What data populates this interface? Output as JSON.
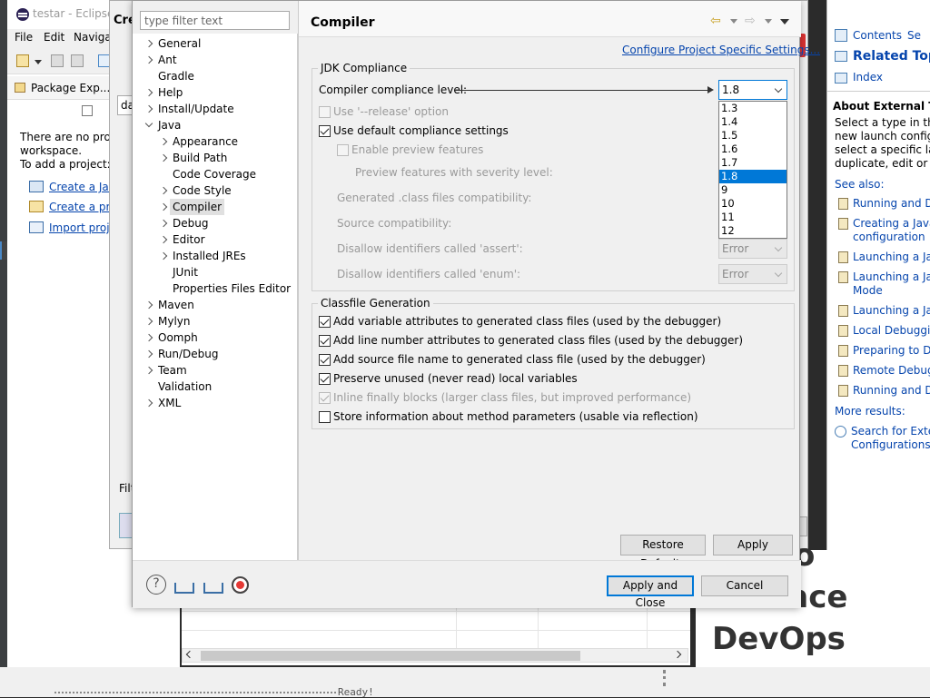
{
  "eclipse": {
    "title": "testar - Eclipse I",
    "menus": [
      "File",
      "Edit",
      "Navigat"
    ],
    "package_explorer_tab": "Package Exp...",
    "empty_text_1": "There are no projec",
    "empty_text_2": "workspace.",
    "empty_text_3": "To add a project:",
    "links": [
      "Create a Java",
      "Create a proj",
      "Import proje"
    ],
    "status": "Ready!"
  },
  "back_dialog": {
    "title": "Cre",
    "field_prefix": "da",
    "filter_prefix": "Filt"
  },
  "help": {
    "tabs": [
      "Contents",
      "Se"
    ],
    "related_topics": "Related Topics",
    "index": "Index",
    "about_heading": "About External Tool",
    "about_body": [
      "Select a type in this t",
      "new launch configu",
      "select a specific laun",
      "duplicate, edit or del"
    ],
    "see_also": "See also:",
    "links": [
      [
        "Running and De"
      ],
      [
        "Creating a Java a",
        "configuration"
      ],
      [
        "Launching a Java"
      ],
      [
        "Launching a Java",
        "Mode"
      ],
      [
        "Launching a Java"
      ],
      [
        "Local Debugging"
      ],
      [
        "Preparing to Deb"
      ],
      [
        "Remote Debugg"
      ],
      [
        "Running and De"
      ]
    ],
    "more_results": "More results:",
    "search_link": [
      "Search for Extern",
      "Configurations"
    ]
  },
  "devops_card": {
    "lines": [
      "o",
      "nce",
      "DevOps"
    ]
  },
  "preferences": {
    "filter_placeholder": "type filter text",
    "tree": [
      {
        "label": "General",
        "depth": 0,
        "expandable": true,
        "expanded": false
      },
      {
        "label": "Ant",
        "depth": 0,
        "expandable": true,
        "expanded": false
      },
      {
        "label": "Gradle",
        "depth": 0,
        "expandable": false,
        "expanded": false
      },
      {
        "label": "Help",
        "depth": 0,
        "expandable": true,
        "expanded": false
      },
      {
        "label": "Install/Update",
        "depth": 0,
        "expandable": true,
        "expanded": false
      },
      {
        "label": "Java",
        "depth": 0,
        "expandable": true,
        "expanded": true
      },
      {
        "label": "Appearance",
        "depth": 1,
        "expandable": true,
        "expanded": false
      },
      {
        "label": "Build Path",
        "depth": 1,
        "expandable": true,
        "expanded": false
      },
      {
        "label": "Code Coverage",
        "depth": 1,
        "expandable": false,
        "expanded": false
      },
      {
        "label": "Code Style",
        "depth": 1,
        "expandable": true,
        "expanded": false
      },
      {
        "label": "Compiler",
        "depth": 1,
        "expandable": true,
        "expanded": false,
        "selected": true
      },
      {
        "label": "Debug",
        "depth": 1,
        "expandable": true,
        "expanded": false
      },
      {
        "label": "Editor",
        "depth": 1,
        "expandable": true,
        "expanded": false
      },
      {
        "label": "Installed JREs",
        "depth": 1,
        "expandable": true,
        "expanded": false
      },
      {
        "label": "JUnit",
        "depth": 1,
        "expandable": false,
        "expanded": false
      },
      {
        "label": "Properties Files Editor",
        "depth": 1,
        "expandable": false,
        "expanded": false
      },
      {
        "label": "Maven",
        "depth": 0,
        "expandable": true,
        "expanded": false
      },
      {
        "label": "Mylyn",
        "depth": 0,
        "expandable": true,
        "expanded": false
      },
      {
        "label": "Oomph",
        "depth": 0,
        "expandable": true,
        "expanded": false
      },
      {
        "label": "Run/Debug",
        "depth": 0,
        "expandable": true,
        "expanded": false
      },
      {
        "label": "Team",
        "depth": 0,
        "expandable": true,
        "expanded": false
      },
      {
        "label": "Validation",
        "depth": 0,
        "expandable": false,
        "expanded": false
      },
      {
        "label": "XML",
        "depth": 0,
        "expandable": true,
        "expanded": false
      }
    ],
    "page_title": "Compiler",
    "configure_link": "Configure Project Specific Settings...",
    "jdk_group": "JDK Compliance",
    "compliance_label": "Compiler compliance level:",
    "compliance_value": "1.8",
    "compliance_options": [
      "1.3",
      "1.4",
      "1.5",
      "1.6",
      "1.7",
      "1.8",
      "9",
      "10",
      "11",
      "12"
    ],
    "release_option": "Use '--release' option",
    "use_default": "Use default compliance settings",
    "enable_preview": "Enable preview features",
    "preview_severity": "Preview features with severity level:",
    "generated_compat": "Generated .class files compatibility:",
    "source_compat": "Source compatibility:",
    "disallow_assert": "Disallow identifiers called 'assert':",
    "disallow_enum": "Disallow identifiers called 'enum':",
    "assert_value": "Error",
    "enum_value": "Error",
    "classfile_group": "Classfile Generation",
    "classfile_options": [
      {
        "label": "Add variable attributes to generated class files (used by the debugger)",
        "checked": true,
        "enabled": true
      },
      {
        "label": "Add line number attributes to generated class files (used by the debugger)",
        "checked": true,
        "enabled": true
      },
      {
        "label": "Add source file name to generated class file (used by the debugger)",
        "checked": true,
        "enabled": true
      },
      {
        "label": "Preserve unused (never read) local variables",
        "checked": true,
        "enabled": true
      },
      {
        "label": "Inline finally blocks (larger class files, but improved performance)",
        "checked": true,
        "enabled": false
      },
      {
        "label": "Store information about method parameters (usable via reflection)",
        "checked": false,
        "enabled": true
      }
    ],
    "restore_defaults": "Restore Defaults",
    "apply": "Apply",
    "apply_and_close": "Apply and Close",
    "cancel": "Cancel",
    "colors": {
      "selection": "#0078d7",
      "link": "#0645ad"
    }
  }
}
